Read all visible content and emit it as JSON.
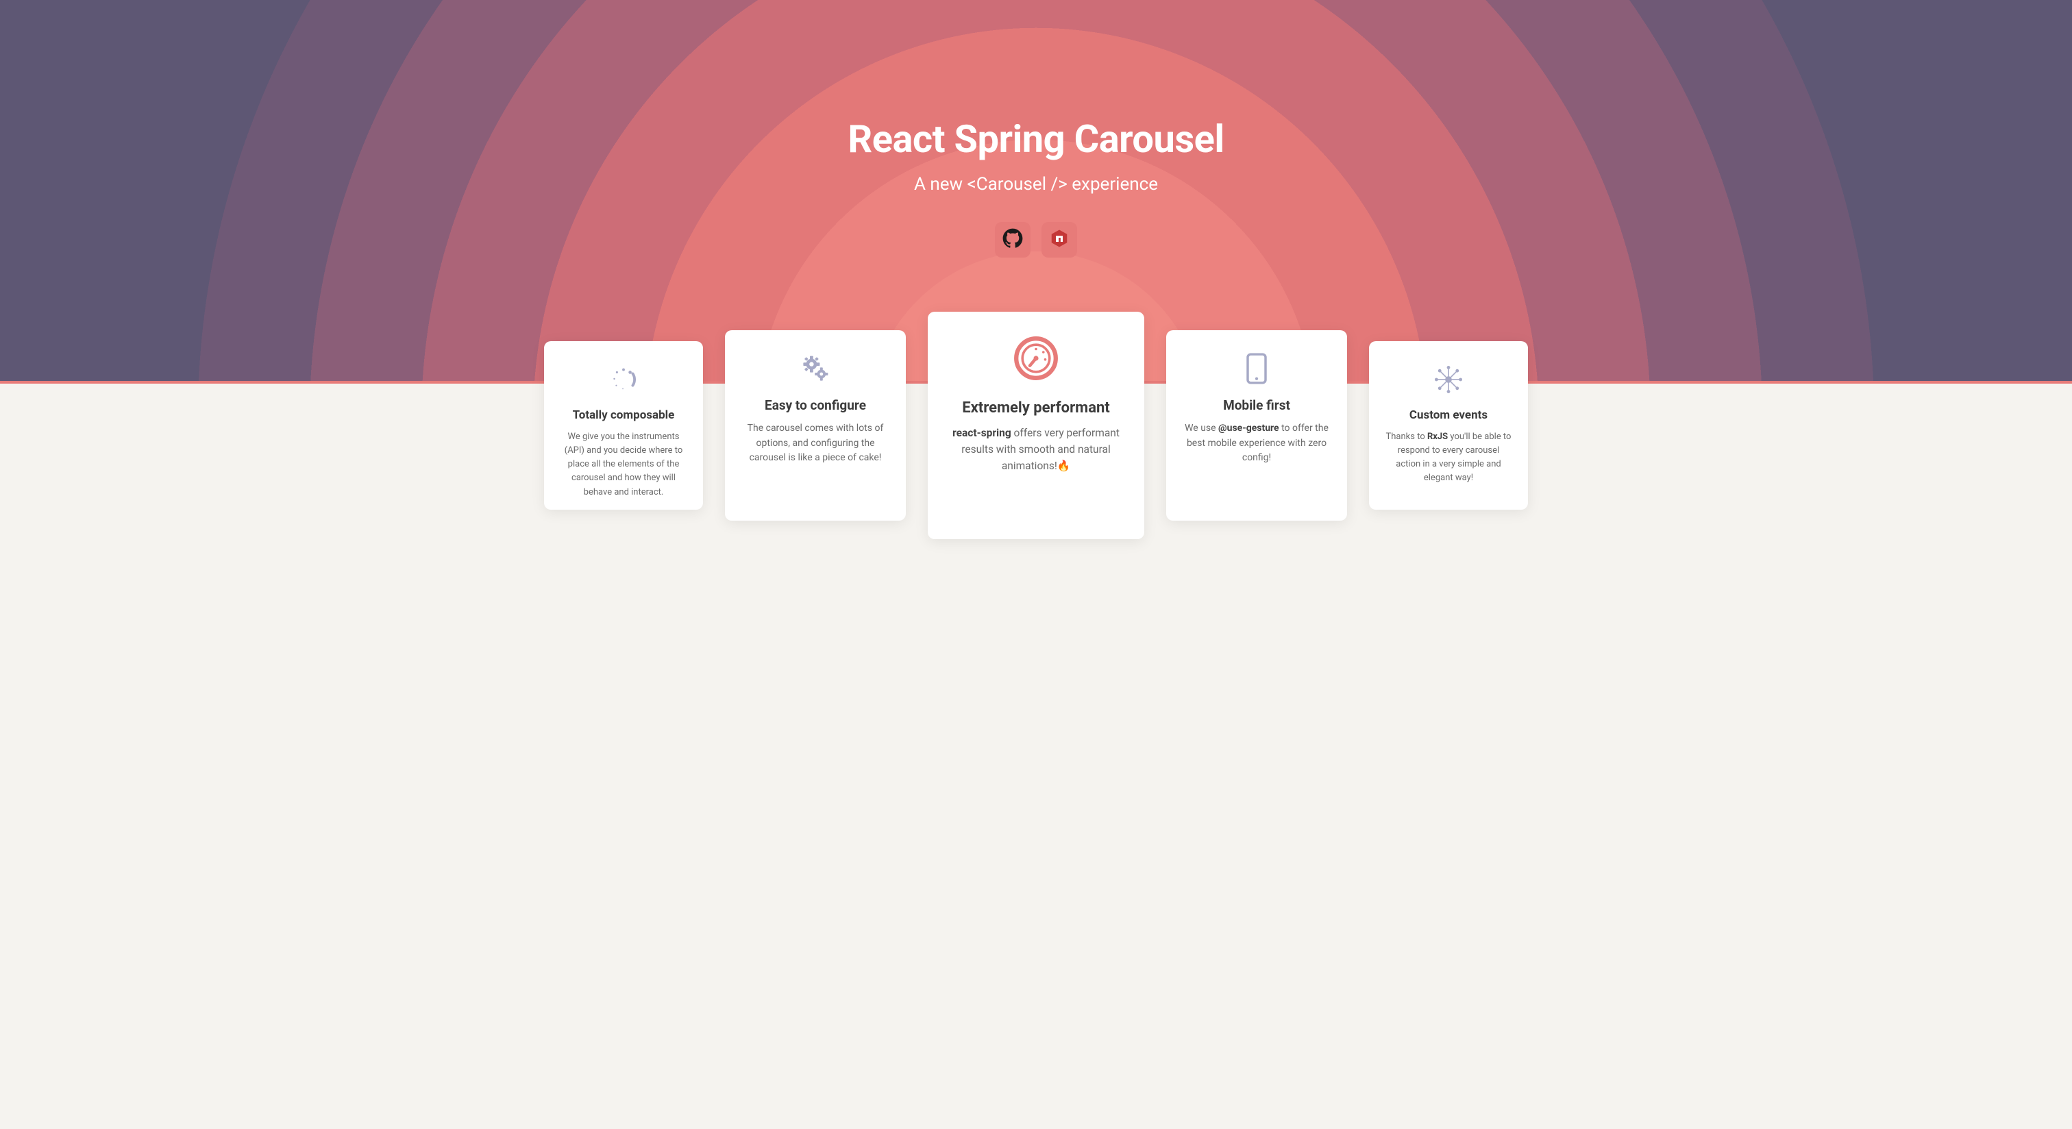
{
  "hero": {
    "title": "React Spring Carousel",
    "subtitle_prefix": "A new ",
    "subtitle_tag": "<Carousel />",
    "subtitle_suffix": " experience",
    "links": {
      "github": "github",
      "npm": "npm"
    }
  },
  "cards": [
    {
      "icon": "spinner",
      "title": "Totally composable",
      "body": "We give you the instruments (API) and you decide where to place all the elements of the carousel and how they will behave and interact."
    },
    {
      "icon": "gears",
      "title": "Easy to configure",
      "body": "The carousel comes with lots of options, and configuring the carousel is like a piece of cake!"
    },
    {
      "icon": "gauge",
      "title": "Extremely performant",
      "body_prefix": "",
      "body_strong1": "react-spring",
      "body_middle": " offers very performant results with smooth and natural animations!",
      "body_emoji": "🔥"
    },
    {
      "icon": "tablet",
      "title": "Mobile first",
      "body_prefix": "We use ",
      "body_strong1": "@use-gesture",
      "body_suffix": " to offer the best mobile experience with zero config!"
    },
    {
      "icon": "network",
      "title": "Custom events",
      "body_prefix": "Thanks to ",
      "body_strong1": "RxJS",
      "body_suffix": " you'll be able to respond to every carousel action in a very simple and elegant way!"
    }
  ]
}
